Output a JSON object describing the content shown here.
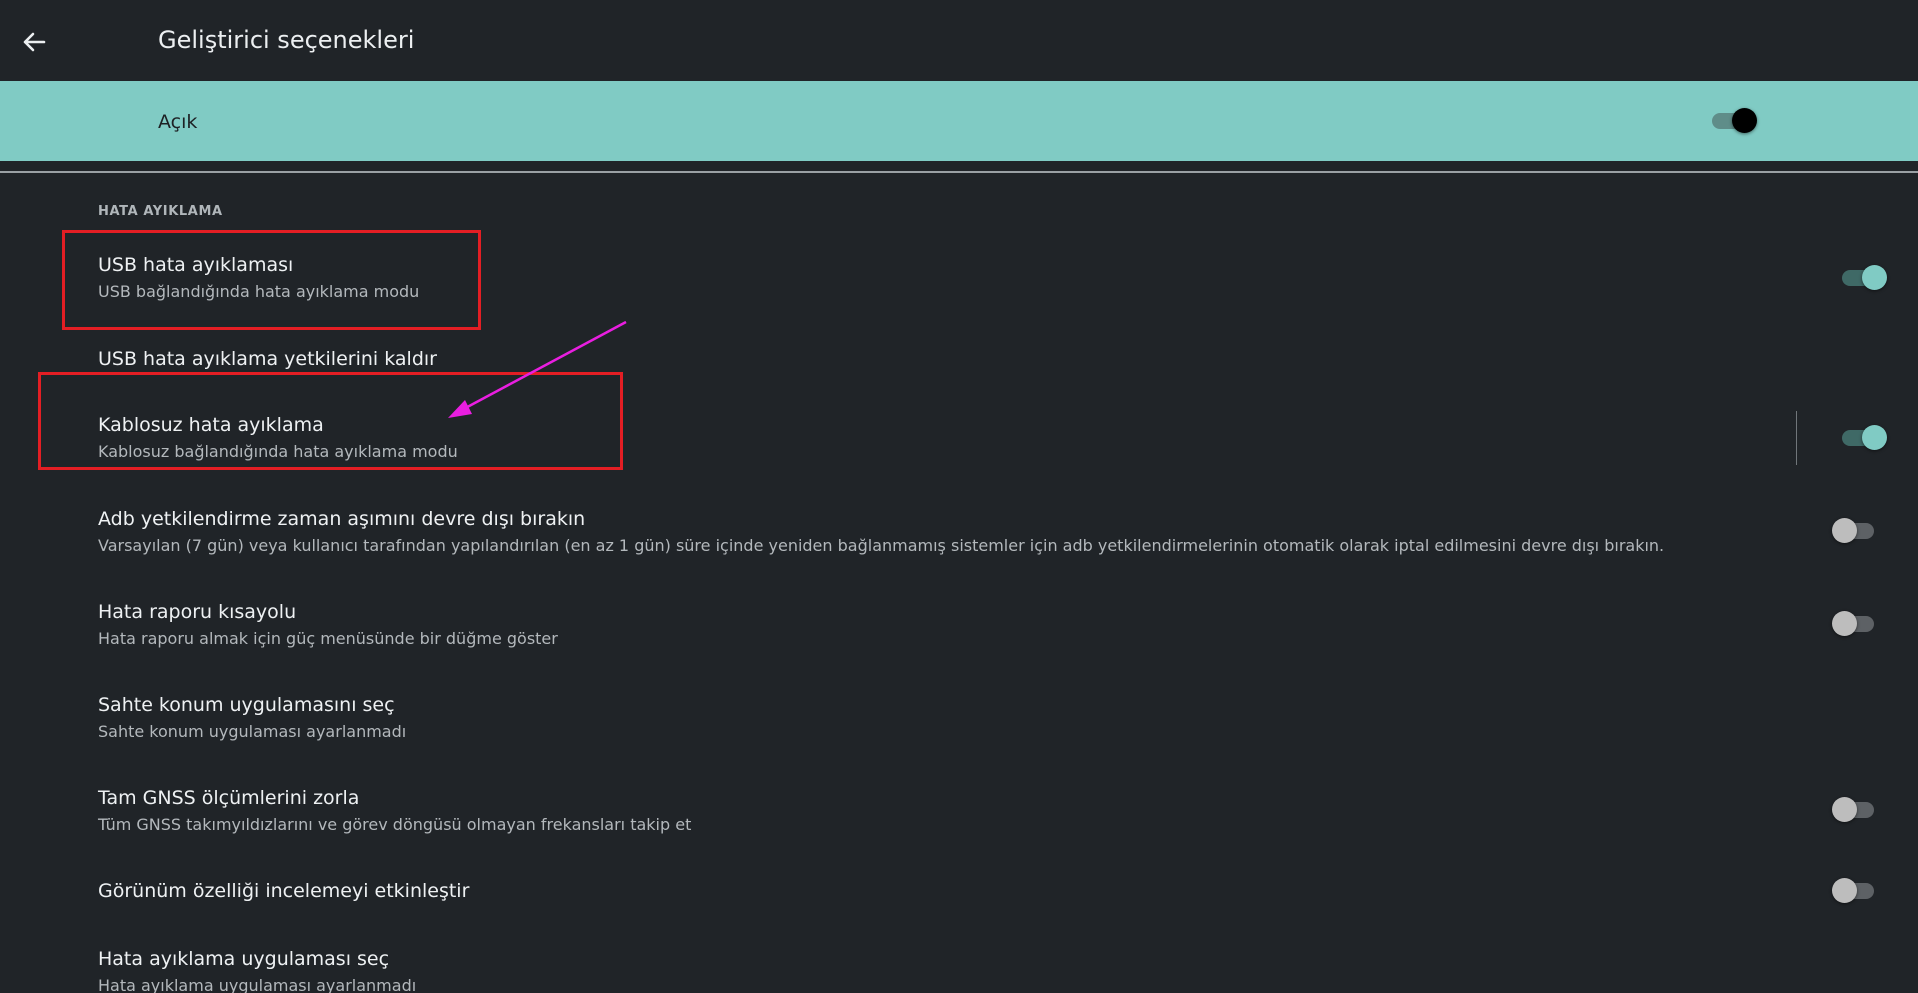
{
  "header": {
    "title": "Geliştirici seçenekleri",
    "back_icon": "arrow-left-icon"
  },
  "master": {
    "label": "Açık",
    "enabled": true
  },
  "section": {
    "header": "HATA AYIKLAMA"
  },
  "items": [
    {
      "title": "USB hata ayıklaması",
      "subtitle": "USB bağlandığında hata ayıklama modu",
      "toggle": "on"
    },
    {
      "title": "USB hata ayıklama yetkilerini kaldır",
      "subtitle": "",
      "toggle": "none"
    },
    {
      "title": "Kablosuz hata ayıklama",
      "subtitle": "Kablosuz bağlandığında hata ayıklama modu",
      "toggle": "on"
    },
    {
      "title": "Adb yetkilendirme zaman aşımını devre dışı bırakın",
      "subtitle": "Varsayılan (7 gün) veya kullanıcı tarafından yapılandırılan (en az 1 gün) süre içinde yeniden bağlanmamış sistemler için adb yetkilendirmelerinin otomatik olarak iptal edilmesini devre dışı bırakın.",
      "toggle": "off"
    },
    {
      "title": "Hata raporu kısayolu",
      "subtitle": "Hata raporu almak için güç menüsünde bir düğme göster",
      "toggle": "off"
    },
    {
      "title": "Sahte konum uygulamasını seç",
      "subtitle": "Sahte konum uygulaması ayarlanmadı",
      "toggle": "none"
    },
    {
      "title": "Tam GNSS ölçümlerini zorla",
      "subtitle": "Tüm GNSS takımyıldızlarını ve görev döngüsü olmayan frekansları takip et",
      "toggle": "off"
    },
    {
      "title": "Görünüm özelliği incelemeyi etkinleştir",
      "subtitle": "",
      "toggle": "off"
    },
    {
      "title": "Hata ayıklama uygulaması seç",
      "subtitle": "Hata ayıklama uygulaması ayarlanmadı",
      "toggle": "none"
    }
  ],
  "colors": {
    "background": "#202428",
    "accent": "#80cbc4",
    "annotation_box": "#e31e24",
    "annotation_arrow": "#e91ee0"
  }
}
